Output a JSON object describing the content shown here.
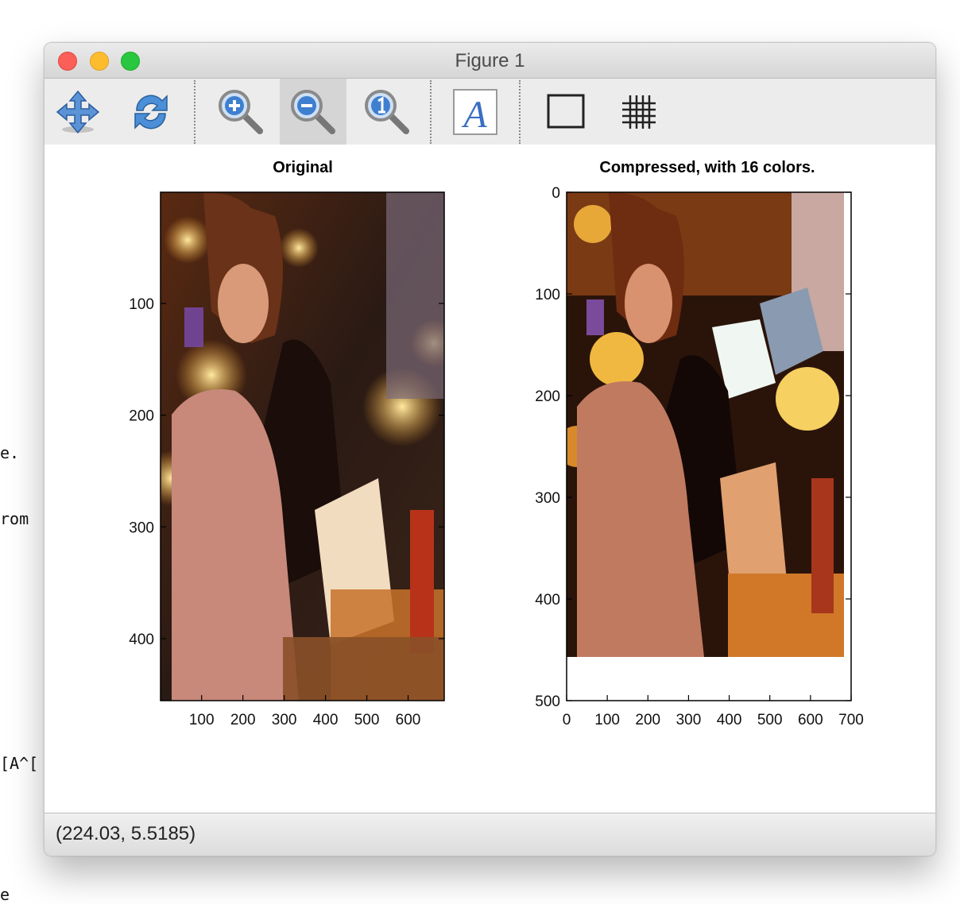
{
  "terminal": {
    "lines": [
      "e.",
      "rom",
      "[A^[",
      "e"
    ]
  },
  "window": {
    "title": "Figure 1",
    "status_text": "(224.03, 5.5185)"
  },
  "toolbar": {
    "tools": [
      {
        "name": "pan",
        "icon": "pan-arrows-icon",
        "pressed": false
      },
      {
        "name": "rotate",
        "icon": "rotate-icon",
        "pressed": false
      },
      {
        "name": "zoom-in",
        "icon": "zoom-in-icon",
        "pressed": false
      },
      {
        "name": "zoom-out",
        "icon": "zoom-out-icon",
        "pressed": true
      },
      {
        "name": "zoom-original",
        "icon": "zoom-reset-icon",
        "pressed": false
      },
      {
        "name": "insert-text",
        "icon": "text-icon",
        "pressed": false
      },
      {
        "name": "axes-box",
        "icon": "box-icon",
        "pressed": false
      },
      {
        "name": "grid",
        "icon": "grid-icon",
        "pressed": false
      }
    ]
  },
  "plots": {
    "left": {
      "title": "Original",
      "xticks": [
        "100",
        "200",
        "300",
        "400",
        "500",
        "600"
      ],
      "yticks": [
        "100",
        "200",
        "300",
        "400"
      ]
    },
    "right": {
      "title": "Compressed, with 16 colors.",
      "xticks": [
        "0",
        "100",
        "200",
        "300",
        "400",
        "500",
        "600",
        "700"
      ],
      "yticks": [
        "0",
        "100",
        "200",
        "300",
        "400",
        "500"
      ]
    }
  },
  "colors": {
    "window_bg": "#ececec",
    "accent_pressed": "#d5d5d5"
  }
}
